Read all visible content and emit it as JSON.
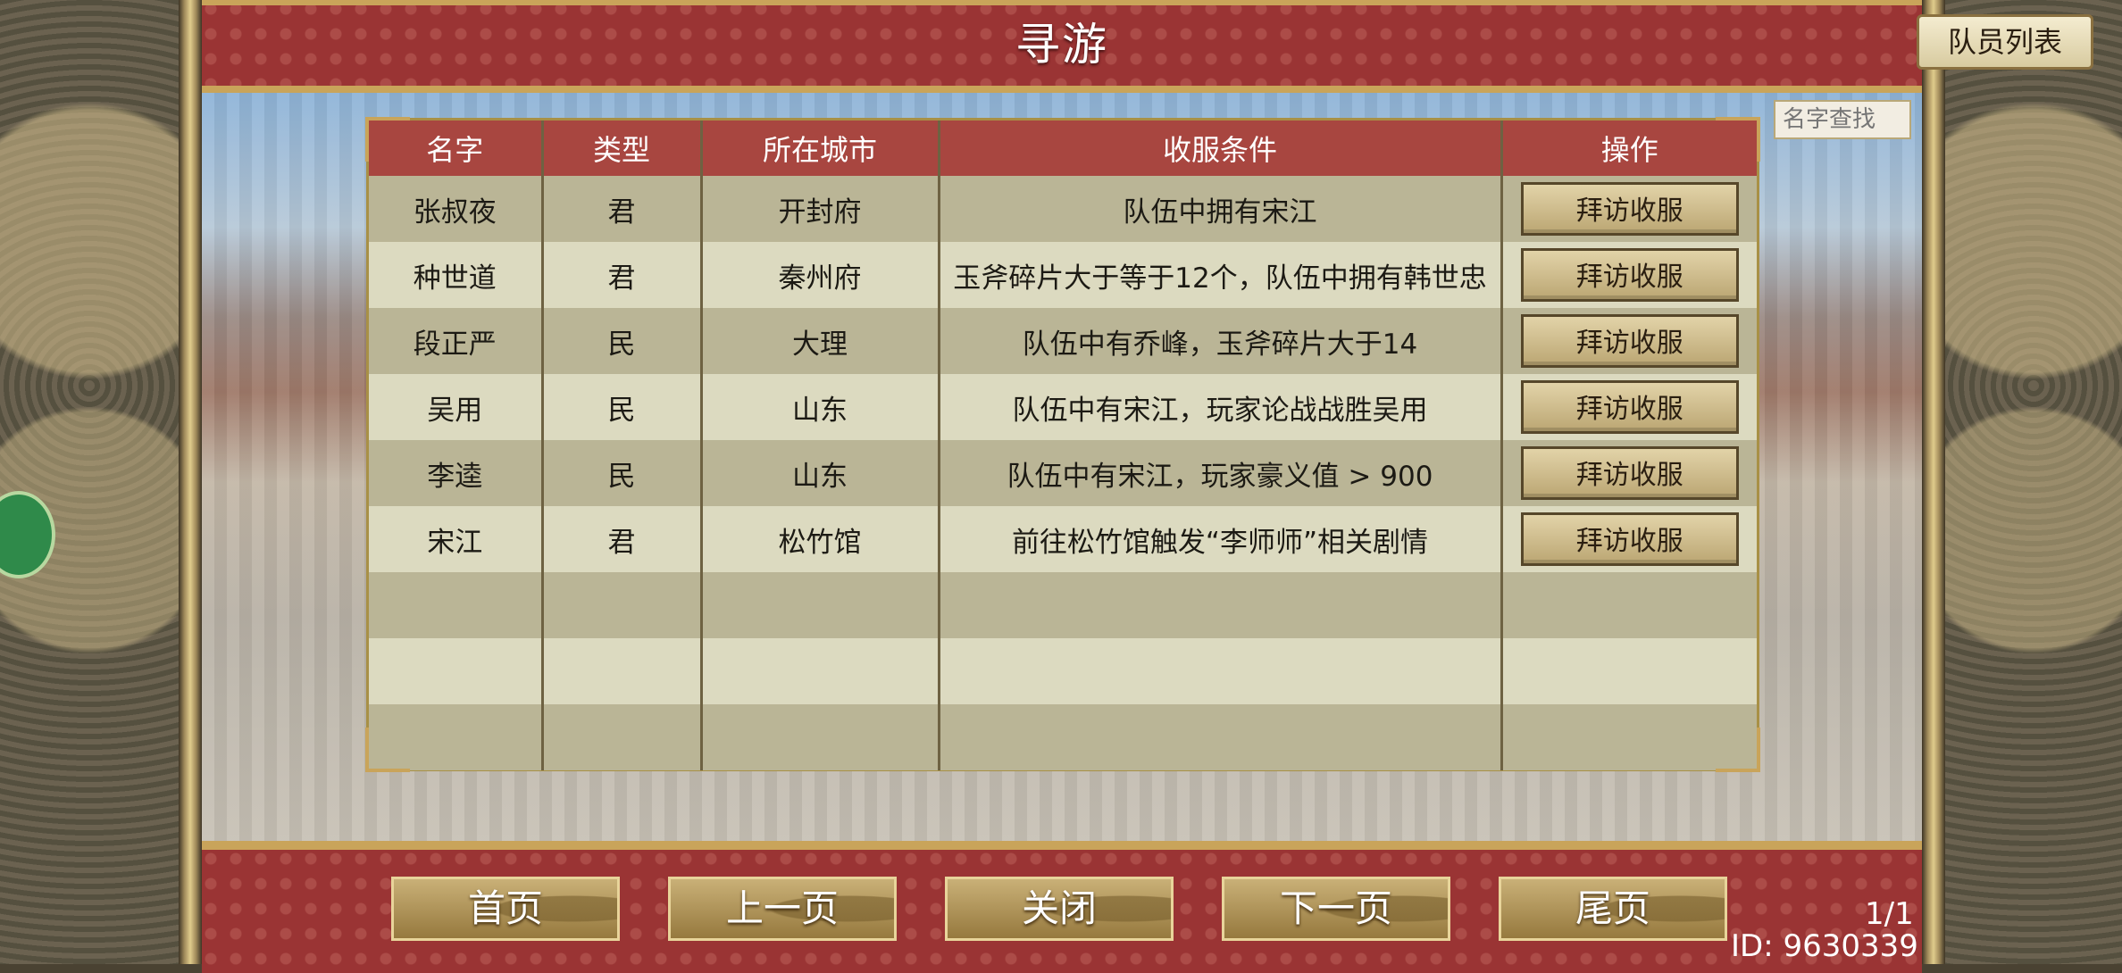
{
  "header": {
    "title": "寻游",
    "team_list_label": "队员列表"
  },
  "search": {
    "placeholder": "名字查找"
  },
  "table": {
    "columns": [
      "名字",
      "类型",
      "所在城市",
      "收服条件",
      "操作"
    ],
    "rows": [
      {
        "name": "张叔夜",
        "type": "君",
        "city": "开封府",
        "condition": "队伍中拥有宋江",
        "action": "拜访收服"
      },
      {
        "name": "种世道",
        "type": "君",
        "city": "秦州府",
        "condition": "玉斧碎片大于等于12个，队伍中拥有韩世忠",
        "action": "拜访收服"
      },
      {
        "name": "段正严",
        "type": "民",
        "city": "大理",
        "condition": "队伍中有乔峰，玉斧碎片大于14",
        "action": "拜访收服"
      },
      {
        "name": "吴用",
        "type": "民",
        "city": "山东",
        "condition": "队伍中有宋江，玩家论战战胜吴用",
        "action": "拜访收服"
      },
      {
        "name": "李逵",
        "type": "民",
        "city": "山东",
        "condition": "队伍中有宋江，玩家豪义值 > 900",
        "action": "拜访收服"
      },
      {
        "name": "宋江",
        "type": "君",
        "city": "松竹馆",
        "condition": "前往松竹馆触发“李师师”相关剧情",
        "action": "拜访收服"
      }
    ]
  },
  "footer": {
    "first": "首页",
    "prev": "上一页",
    "close": "关闭",
    "next": "下一页",
    "last": "尾页",
    "page": "1/1",
    "id": "ID: 9630339"
  }
}
